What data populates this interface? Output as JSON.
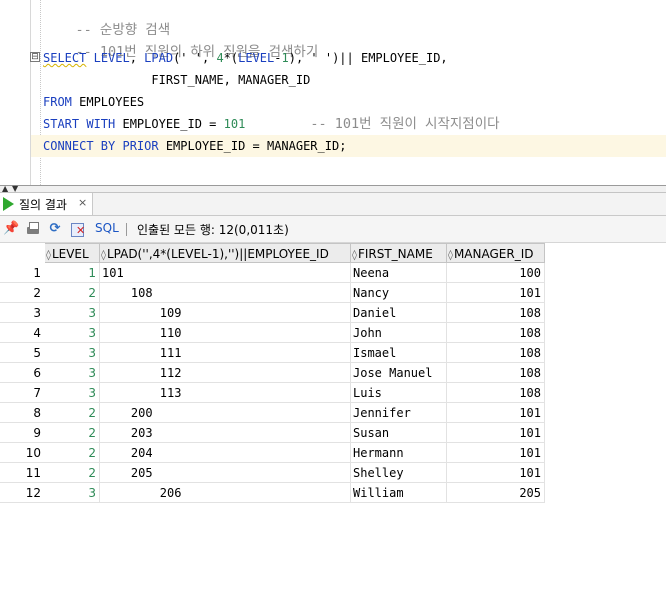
{
  "editor": {
    "comment_1": "-- 순방향 검색",
    "comment_2": "-- 101번 직원의 하위 직원을 검색하기",
    "select_kw": "SELECT",
    "level_kw": "LEVEL",
    "lpad_fn": "LPAD",
    "lpad_open": "('",
    "lpad_sp1": " ', ",
    "four": "4",
    "mul_open": "*(",
    "level_kw2": "LEVEL",
    "minus": "-",
    "one": "1",
    "lpad_rest": "), ' ')|| EMPLOYEE_ID,",
    "line2": "               FIRST_NAME, MANAGER_ID",
    "from_kw": "FROM",
    "from_rest": " EMPLOYEES",
    "start_kw": "START WITH",
    "start_rest": " EMPLOYEE_ID = ",
    "start_num": "101",
    "start_comment": "        -- 101번 직원이 시작지점이다",
    "connect_kw": "CONNECT BY PRIOR",
    "connect_rest": " EMPLOYEE_ID = MANAGER_ID;",
    "fold_glyph": "⊟"
  },
  "splitter": {
    "up": "▲",
    "down": "▼"
  },
  "results_tab": {
    "label": "질의 결과",
    "close": "×"
  },
  "toolbar": {
    "sql_label": "SQL",
    "status": "인출된 모든 행: 12(0,011초)",
    "refresh_glyph": "⟳"
  },
  "grid": {
    "columns": [
      {
        "sort": "◊",
        "label": "LEVEL"
      },
      {
        "sort": "◊",
        "label": "LPAD('',4*(LEVEL-1),'')||EMPLOYEE_ID"
      },
      {
        "sort": "◊",
        "label": "FIRST_NAME"
      },
      {
        "sort": "◊",
        "label": "MANAGER_ID"
      }
    ],
    "rows": [
      {
        "n": "1",
        "level": "1",
        "lpad": "101",
        "first_name": "Neena",
        "manager_id": "100"
      },
      {
        "n": "2",
        "level": "2",
        "lpad": "    108",
        "first_name": "Nancy",
        "manager_id": "101"
      },
      {
        "n": "3",
        "level": "3",
        "lpad": "        109",
        "first_name": "Daniel",
        "manager_id": "108"
      },
      {
        "n": "4",
        "level": "3",
        "lpad": "        110",
        "first_name": "John",
        "manager_id": "108"
      },
      {
        "n": "5",
        "level": "3",
        "lpad": "        111",
        "first_name": "Ismael",
        "manager_id": "108"
      },
      {
        "n": "6",
        "level": "3",
        "lpad": "        112",
        "first_name": "Jose Manuel",
        "manager_id": "108"
      },
      {
        "n": "7",
        "level": "3",
        "lpad": "        113",
        "first_name": "Luis",
        "manager_id": "108"
      },
      {
        "n": "8",
        "level": "2",
        "lpad": "    200",
        "first_name": "Jennifer",
        "manager_id": "101"
      },
      {
        "n": "9",
        "level": "2",
        "lpad": "    203",
        "first_name": "Susan",
        "manager_id": "101"
      },
      {
        "n": "10",
        "level": "2",
        "lpad": "    204",
        "first_name": "Hermann",
        "manager_id": "101"
      },
      {
        "n": "11",
        "level": "2",
        "lpad": "    205",
        "first_name": "Shelley",
        "manager_id": "101"
      },
      {
        "n": "12",
        "level": "3",
        "lpad": "        206",
        "first_name": "William",
        "manager_id": "205"
      }
    ]
  }
}
